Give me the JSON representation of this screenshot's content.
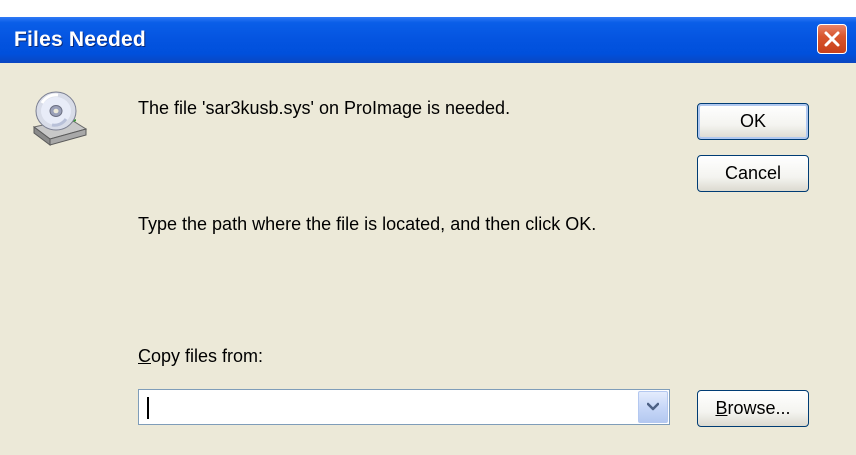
{
  "window": {
    "title": "Files Needed"
  },
  "message": {
    "needed": "The file 'sar3kusb.sys' on ProImage is needed.",
    "instruction": "Type the path where the file is located, and then click OK."
  },
  "buttons": {
    "ok": "OK",
    "cancel": "Cancel",
    "browse_prefix": "B",
    "browse_rest": "rowse..."
  },
  "copy_from": {
    "label_prefix": "C",
    "label_rest": "opy files from:",
    "value": ""
  },
  "icons": {
    "dialog_icon": "cd-drive-icon",
    "close": "close-icon",
    "dropdown": "chevron-down-icon"
  },
  "colors": {
    "titlebar": "#0454e0",
    "dialog_bg": "#ece9d8",
    "close_button": "#d8562e"
  }
}
